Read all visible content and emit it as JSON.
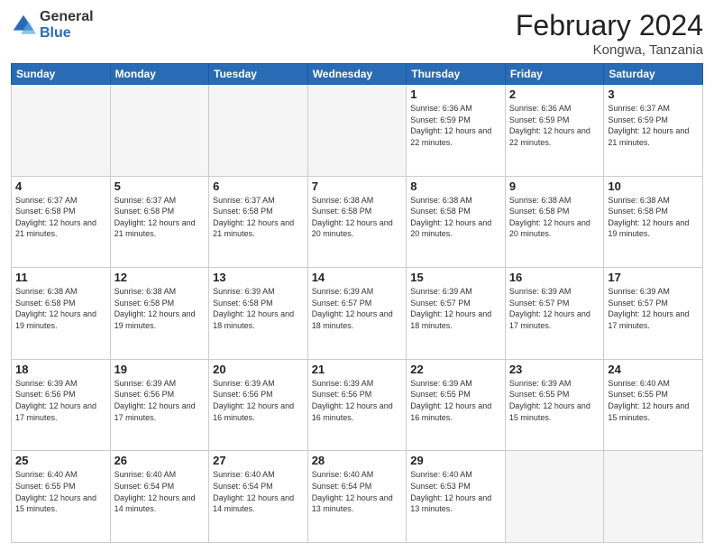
{
  "header": {
    "logo_general": "General",
    "logo_blue": "Blue",
    "month_year": "February 2024",
    "location": "Kongwa, Tanzania"
  },
  "days_of_week": [
    "Sunday",
    "Monday",
    "Tuesday",
    "Wednesday",
    "Thursday",
    "Friday",
    "Saturday"
  ],
  "weeks": [
    [
      {
        "day": "",
        "info": ""
      },
      {
        "day": "",
        "info": ""
      },
      {
        "day": "",
        "info": ""
      },
      {
        "day": "",
        "info": ""
      },
      {
        "day": "1",
        "info": "Sunrise: 6:36 AM\nSunset: 6:59 PM\nDaylight: 12 hours\nand 22 minutes."
      },
      {
        "day": "2",
        "info": "Sunrise: 6:36 AM\nSunset: 6:59 PM\nDaylight: 12 hours\nand 22 minutes."
      },
      {
        "day": "3",
        "info": "Sunrise: 6:37 AM\nSunset: 6:59 PM\nDaylight: 12 hours\nand 21 minutes."
      }
    ],
    [
      {
        "day": "4",
        "info": "Sunrise: 6:37 AM\nSunset: 6:58 PM\nDaylight: 12 hours\nand 21 minutes."
      },
      {
        "day": "5",
        "info": "Sunrise: 6:37 AM\nSunset: 6:58 PM\nDaylight: 12 hours\nand 21 minutes."
      },
      {
        "day": "6",
        "info": "Sunrise: 6:37 AM\nSunset: 6:58 PM\nDaylight: 12 hours\nand 21 minutes."
      },
      {
        "day": "7",
        "info": "Sunrise: 6:38 AM\nSunset: 6:58 PM\nDaylight: 12 hours\nand 20 minutes."
      },
      {
        "day": "8",
        "info": "Sunrise: 6:38 AM\nSunset: 6:58 PM\nDaylight: 12 hours\nand 20 minutes."
      },
      {
        "day": "9",
        "info": "Sunrise: 6:38 AM\nSunset: 6:58 PM\nDaylight: 12 hours\nand 20 minutes."
      },
      {
        "day": "10",
        "info": "Sunrise: 6:38 AM\nSunset: 6:58 PM\nDaylight: 12 hours\nand 19 minutes."
      }
    ],
    [
      {
        "day": "11",
        "info": "Sunrise: 6:38 AM\nSunset: 6:58 PM\nDaylight: 12 hours\nand 19 minutes."
      },
      {
        "day": "12",
        "info": "Sunrise: 6:38 AM\nSunset: 6:58 PM\nDaylight: 12 hours\nand 19 minutes."
      },
      {
        "day": "13",
        "info": "Sunrise: 6:39 AM\nSunset: 6:58 PM\nDaylight: 12 hours\nand 18 minutes."
      },
      {
        "day": "14",
        "info": "Sunrise: 6:39 AM\nSunset: 6:57 PM\nDaylight: 12 hours\nand 18 minutes."
      },
      {
        "day": "15",
        "info": "Sunrise: 6:39 AM\nSunset: 6:57 PM\nDaylight: 12 hours\nand 18 minutes."
      },
      {
        "day": "16",
        "info": "Sunrise: 6:39 AM\nSunset: 6:57 PM\nDaylight: 12 hours\nand 17 minutes."
      },
      {
        "day": "17",
        "info": "Sunrise: 6:39 AM\nSunset: 6:57 PM\nDaylight: 12 hours\nand 17 minutes."
      }
    ],
    [
      {
        "day": "18",
        "info": "Sunrise: 6:39 AM\nSunset: 6:56 PM\nDaylight: 12 hours\nand 17 minutes."
      },
      {
        "day": "19",
        "info": "Sunrise: 6:39 AM\nSunset: 6:56 PM\nDaylight: 12 hours\nand 17 minutes."
      },
      {
        "day": "20",
        "info": "Sunrise: 6:39 AM\nSunset: 6:56 PM\nDaylight: 12 hours\nand 16 minutes."
      },
      {
        "day": "21",
        "info": "Sunrise: 6:39 AM\nSunset: 6:56 PM\nDaylight: 12 hours\nand 16 minutes."
      },
      {
        "day": "22",
        "info": "Sunrise: 6:39 AM\nSunset: 6:55 PM\nDaylight: 12 hours\nand 16 minutes."
      },
      {
        "day": "23",
        "info": "Sunrise: 6:39 AM\nSunset: 6:55 PM\nDaylight: 12 hours\nand 15 minutes."
      },
      {
        "day": "24",
        "info": "Sunrise: 6:40 AM\nSunset: 6:55 PM\nDaylight: 12 hours\nand 15 minutes."
      }
    ],
    [
      {
        "day": "25",
        "info": "Sunrise: 6:40 AM\nSunset: 6:55 PM\nDaylight: 12 hours\nand 15 minutes."
      },
      {
        "day": "26",
        "info": "Sunrise: 6:40 AM\nSunset: 6:54 PM\nDaylight: 12 hours\nand 14 minutes."
      },
      {
        "day": "27",
        "info": "Sunrise: 6:40 AM\nSunset: 6:54 PM\nDaylight: 12 hours\nand 14 minutes."
      },
      {
        "day": "28",
        "info": "Sunrise: 6:40 AM\nSunset: 6:54 PM\nDaylight: 12 hours\nand 13 minutes."
      },
      {
        "day": "29",
        "info": "Sunrise: 6:40 AM\nSunset: 6:53 PM\nDaylight: 12 hours\nand 13 minutes."
      },
      {
        "day": "",
        "info": ""
      },
      {
        "day": "",
        "info": ""
      }
    ]
  ]
}
